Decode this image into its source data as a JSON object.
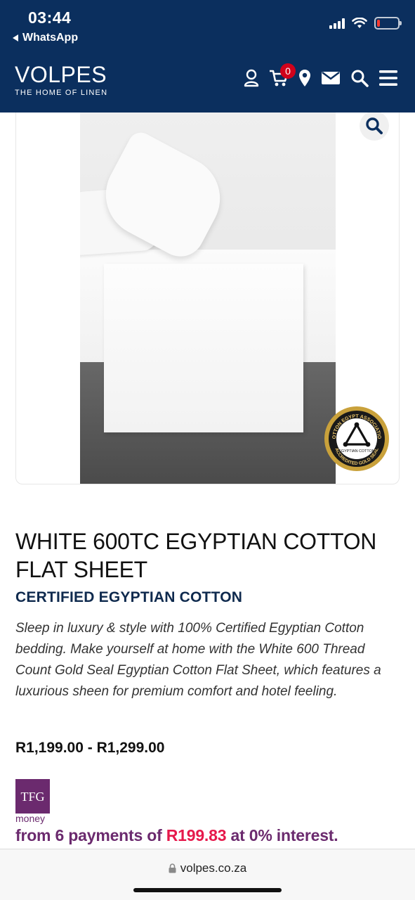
{
  "status_bar": {
    "time": "03:44",
    "back_app": "WhatsApp",
    "battery_color": "#ff3b30"
  },
  "header": {
    "brand": "VOLPES",
    "tagline": "THE HOME OF LINEN",
    "background_color": "#0b2f5e",
    "cart_count": "0",
    "icons": [
      "account-icon",
      "cart-icon",
      "location-icon",
      "mail-icon",
      "search-icon",
      "menu-icon"
    ]
  },
  "product": {
    "title": "WHITE 600TC EGYPTIAN COTTON FLAT SHEET",
    "subtitle": "CERTIFIED EGYPTIAN COTTON",
    "description": "Sleep in luxury & style with 100% Certified Egyptian Cotton bedding. Make yourself at home with the White 600 Thread Count Gold Seal Egyptian Cotton Flat Sheet, which features a luxurious sheen for premium comfort and hotel feeling.",
    "price_range": "R1,199.00 - R1,299.00",
    "seal_top_text": "COTTON EGYPT ASSOCIATION",
    "seal_center_text": "EGYPTIAN COTTON",
    "seal_bottom_text": "ACCREDITED GOLD SEAL"
  },
  "finance": {
    "logo_text": "TFG",
    "logo_sub": "money",
    "prefix": "from 6 payments of ",
    "amount": "R199.83",
    "suffix": " at 0% interest.",
    "brand_color": "#6b2a6e",
    "amount_color": "#e6194b"
  },
  "browser": {
    "url": "volpes.co.za"
  }
}
